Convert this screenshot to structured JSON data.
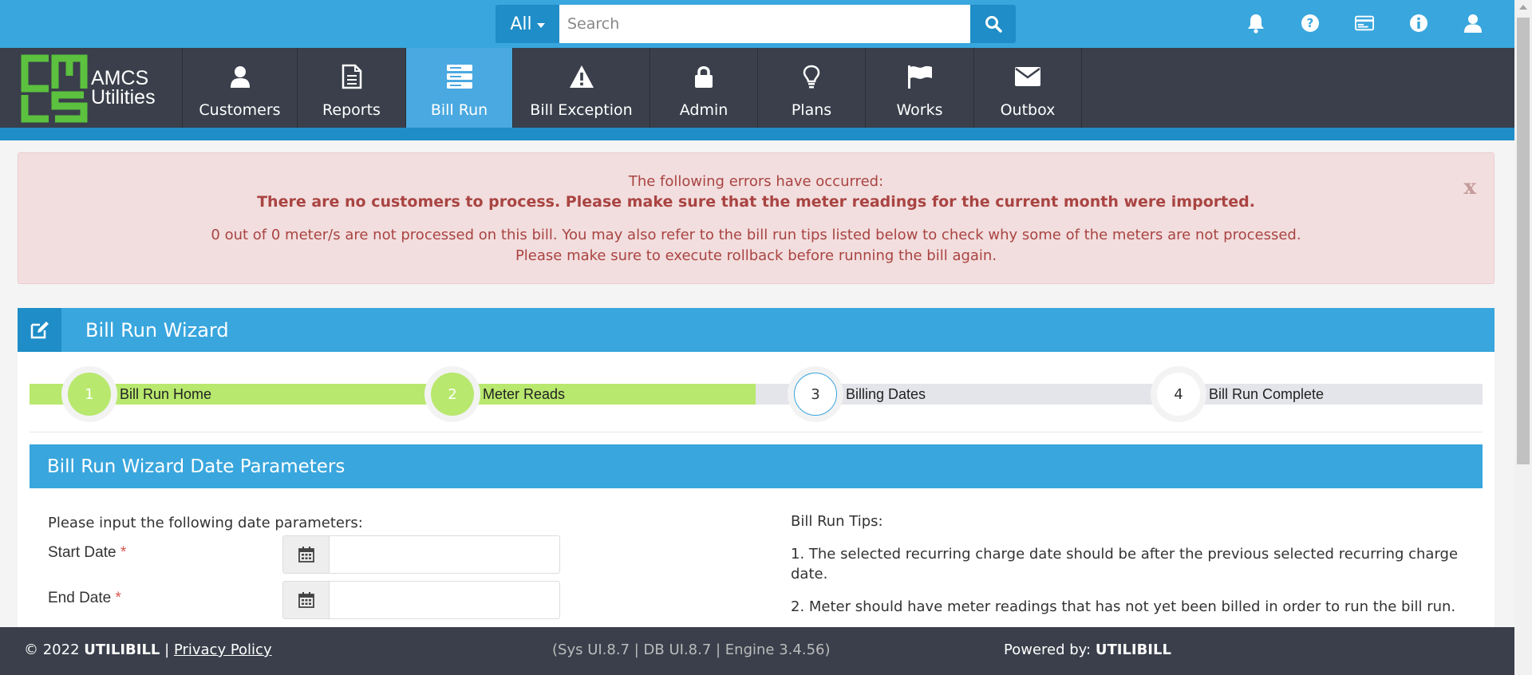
{
  "search": {
    "category": "All",
    "placeholder": "Search"
  },
  "top_icons": [
    "bell-icon",
    "question-icon",
    "card-icon",
    "info-icon",
    "user-icon"
  ],
  "logo": {
    "line1": "AMCS",
    "line2": "Utilities"
  },
  "nav": [
    {
      "label": "Customers",
      "icon": "user-icon"
    },
    {
      "label": "Reports",
      "icon": "document-icon"
    },
    {
      "label": "Bill Run",
      "icon": "server-icon",
      "active": true
    },
    {
      "label": "Bill Exception",
      "icon": "warning-icon"
    },
    {
      "label": "Admin",
      "icon": "lock-icon"
    },
    {
      "label": "Plans",
      "icon": "lightbulb-icon"
    },
    {
      "label": "Works",
      "icon": "flag-icon"
    },
    {
      "label": "Outbox",
      "icon": "envelope-icon"
    }
  ],
  "alert": {
    "line1": "The following errors have occurred:",
    "line2": "There are no customers to process. Please make sure that the meter readings for the current month were imported.",
    "line3": "0 out of 0 meter/s are not processed on this bill. You may also refer to the bill run tips listed below to check why some of the meters are not processed.",
    "line4": "Please make sure to execute rollback before running the bill again.",
    "close": "x"
  },
  "wizard": {
    "title": "Bill Run Wizard",
    "steps": [
      {
        "number": "1",
        "label": "Bill Run Home",
        "state": "done"
      },
      {
        "number": "2",
        "label": "Meter Reads",
        "state": "done"
      },
      {
        "number": "3",
        "label": "Billing Dates",
        "state": "current"
      },
      {
        "number": "4",
        "label": "Bill Run Complete",
        "state": "todo"
      }
    ],
    "params_title": "Bill Run Wizard Date Parameters",
    "intro": "Please input the following date parameters:",
    "start_date_label": "Start Date",
    "end_date_label": "End Date",
    "required_mark": "*",
    "tips_title": "Bill Run Tips:",
    "tip1": "1. The selected recurring charge date should be after the previous selected recurring charge date.",
    "tip2": "2. Meter should have meter readings that has not yet been billed in order to run the bill run."
  },
  "footer": {
    "copyright": "© 2022",
    "brand": "UTILIBILL",
    "separator": "|",
    "privacy": "Privacy Policy",
    "versions": "(Sys UI.8.7 | DB UI.8.7 | Engine 3.4.56)",
    "powered_label": "Powered by:",
    "powered_brand": "UTILIBILL"
  },
  "colors": {
    "topbar": "#39a6dd",
    "accent_dark": "#1f8dc7",
    "navbar": "#3a3f4b",
    "step_done": "#b8e86e",
    "alert_bg": "#f2dede",
    "alert_text": "#a94442",
    "logo_green": "#5cc13e"
  }
}
